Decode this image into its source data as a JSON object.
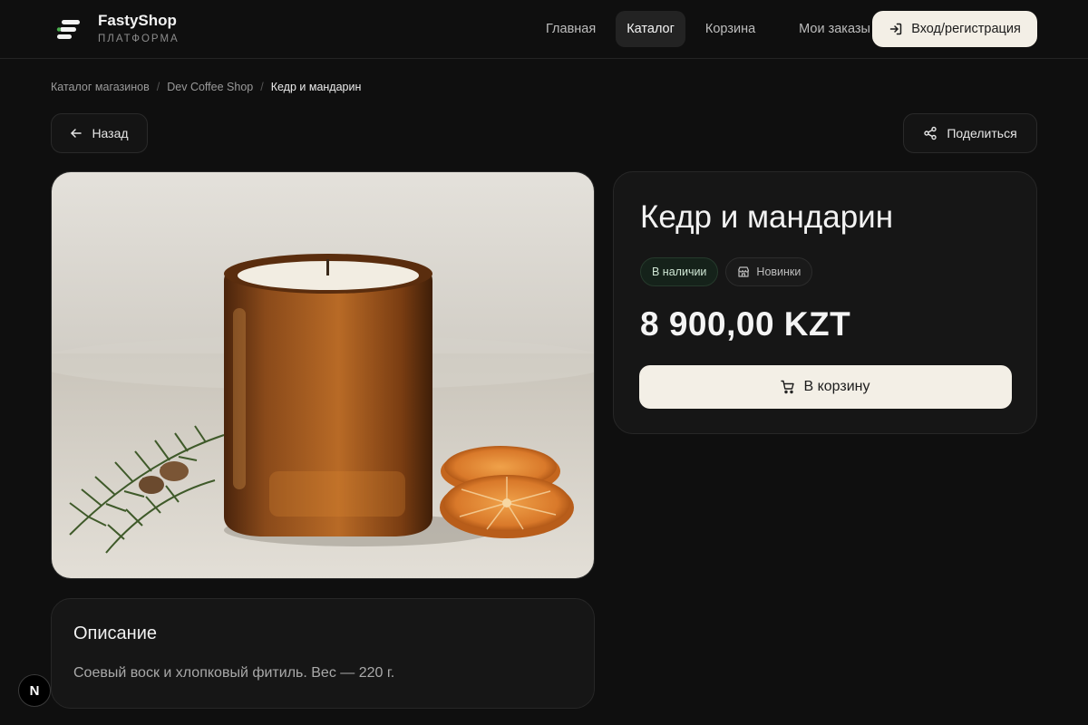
{
  "brand": {
    "name": "FastyShop",
    "subtitle": "ПЛАТФОРМА",
    "accent": "#4caf50"
  },
  "nav": {
    "items": [
      {
        "label": "Главная",
        "active": false
      },
      {
        "label": "Каталог",
        "active": true
      },
      {
        "label": "Корзина",
        "active": false
      },
      {
        "label": "Мои заказы",
        "active": false
      }
    ],
    "login_label": "Вход/регистрация"
  },
  "breadcrumb": [
    {
      "label": "Каталог магазинов"
    },
    {
      "label": "Dev Coffee Shop"
    },
    {
      "label": "Кедр и мандарин"
    }
  ],
  "actions": {
    "back_label": "Назад",
    "share_label": "Поделиться"
  },
  "product": {
    "title": "Кедр и мандарин",
    "stock_badge": "В наличии",
    "category_badge": "Новинки",
    "price": "8 900,00 KZT",
    "add_to_cart_label": "В корзину",
    "image_alt": "amber-jar-candle-photo"
  },
  "description": {
    "heading": "Описание",
    "text": "Соевый воск и хлопковый фитиль. Вес — 220 г."
  },
  "dev_badge": {
    "label": "N"
  },
  "colors": {
    "background": "#0f0f0f",
    "card": "#161616",
    "primary_button": "#f3efe6",
    "stock_badge": "#15221a"
  }
}
